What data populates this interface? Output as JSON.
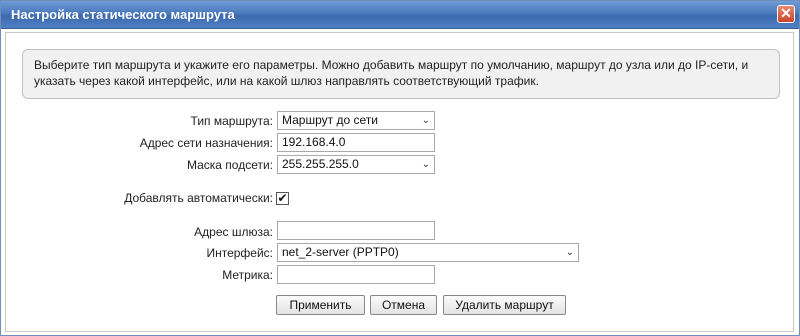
{
  "window": {
    "title": "Настройка статического маршрута",
    "close_icon": "✕"
  },
  "info_text": "Выберите тип маршрута и укажите его параметры. Можно добавить маршрут по умолчанию, маршрут до узла или до IP-сети, и указать через какой интерфейс, или на какой шлюз направлять соответствующий трафик.",
  "form": {
    "route_type": {
      "label": "Тип маршрута:",
      "value": "Маршрут до сети"
    },
    "dest_network": {
      "label": "Адрес сети назначения:",
      "value": "192.168.4.0"
    },
    "subnet_mask": {
      "label": "Маска подсети:",
      "value": "255.255.255.0"
    },
    "auto_add": {
      "label": "Добавлять автоматически:",
      "checked": true,
      "check_glyph": "✔"
    },
    "gateway": {
      "label": "Адрес шлюза:",
      "value": ""
    },
    "interface": {
      "label": "Интерфейс:",
      "value": "net_2-server (PPTP0)"
    },
    "metric": {
      "label": "Метрика:",
      "value": ""
    }
  },
  "buttons": {
    "apply": "Применить",
    "cancel": "Отмена",
    "delete": "Удалить маршрут"
  },
  "colors": {
    "titlebar": "#4a79bd",
    "info_bg": "#f1f1f1"
  }
}
